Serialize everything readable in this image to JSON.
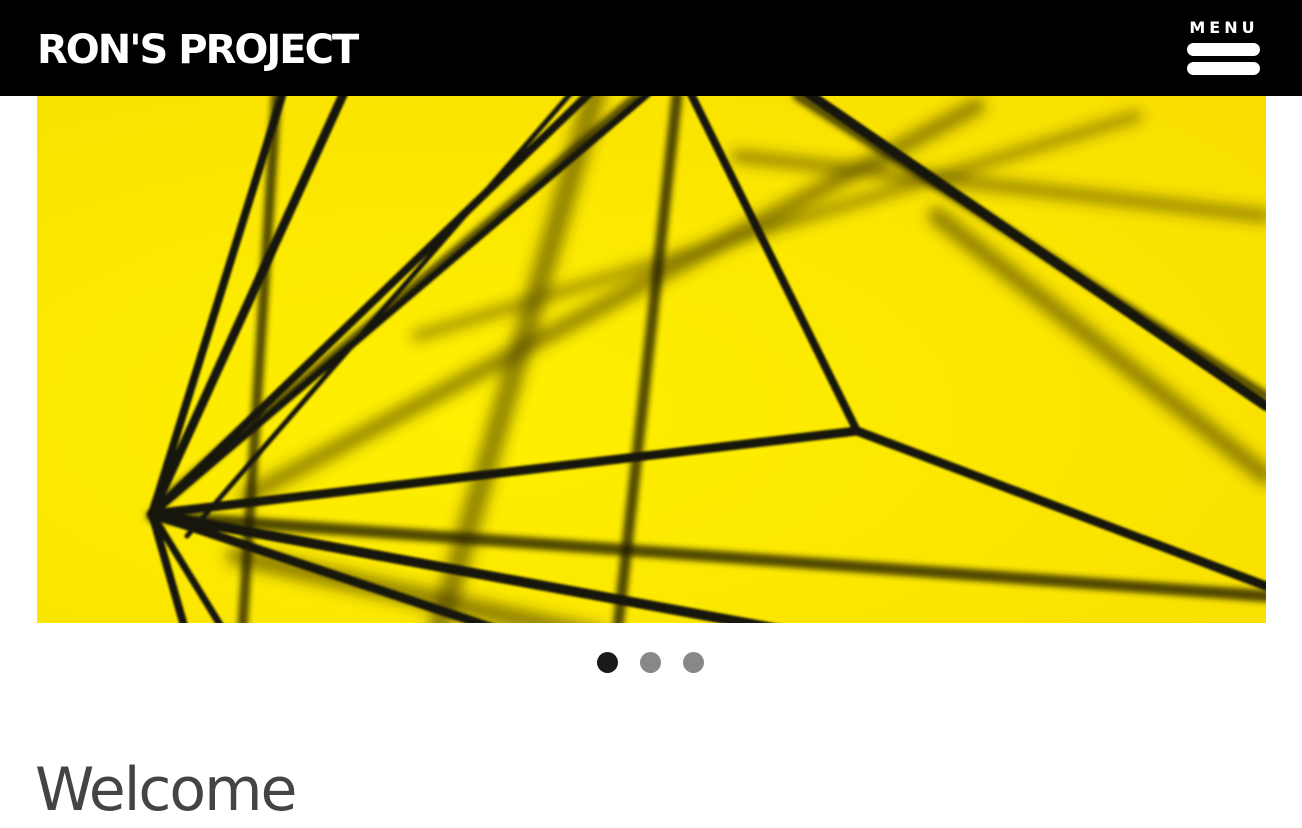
{
  "header": {
    "site_title": "RON'S PROJECT",
    "menu_label": "MENU"
  },
  "slider": {
    "slide_count": 3,
    "active_slide": 1,
    "image_subject": "black wire geometric polyhedron on yellow background",
    "dots": [
      "slide-1",
      "slide-2",
      "slide-3"
    ]
  },
  "main": {
    "heading": "Welcome"
  },
  "colors": {
    "header_bg": "#000000",
    "header_text": "#ffffff",
    "hero_bg": "#ffe600",
    "wire": "#1c1a0a",
    "dot_active": "#1a1a1a",
    "dot_inactive": "#888888",
    "heading_text": "#444444"
  },
  "icons": {
    "menu": "hamburger-menu-icon"
  }
}
